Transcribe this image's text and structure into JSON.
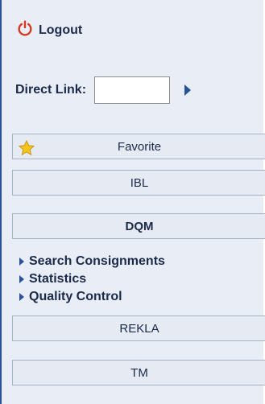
{
  "header": {
    "logout_label": "Logout"
  },
  "direct_link": {
    "label": "Direct Link:",
    "value": "",
    "placeholder": ""
  },
  "menu": {
    "favorite": "Favorite",
    "ibl": "IBL",
    "dqm": "DQM",
    "dqm_links": [
      "Search Consignments",
      "Statistics",
      "Quality Control"
    ],
    "rekla": "REKLA",
    "tm": "TM"
  },
  "colors": {
    "accent": "#2a5297",
    "logout_icon": "#d9361c",
    "star": "#f5c518"
  }
}
